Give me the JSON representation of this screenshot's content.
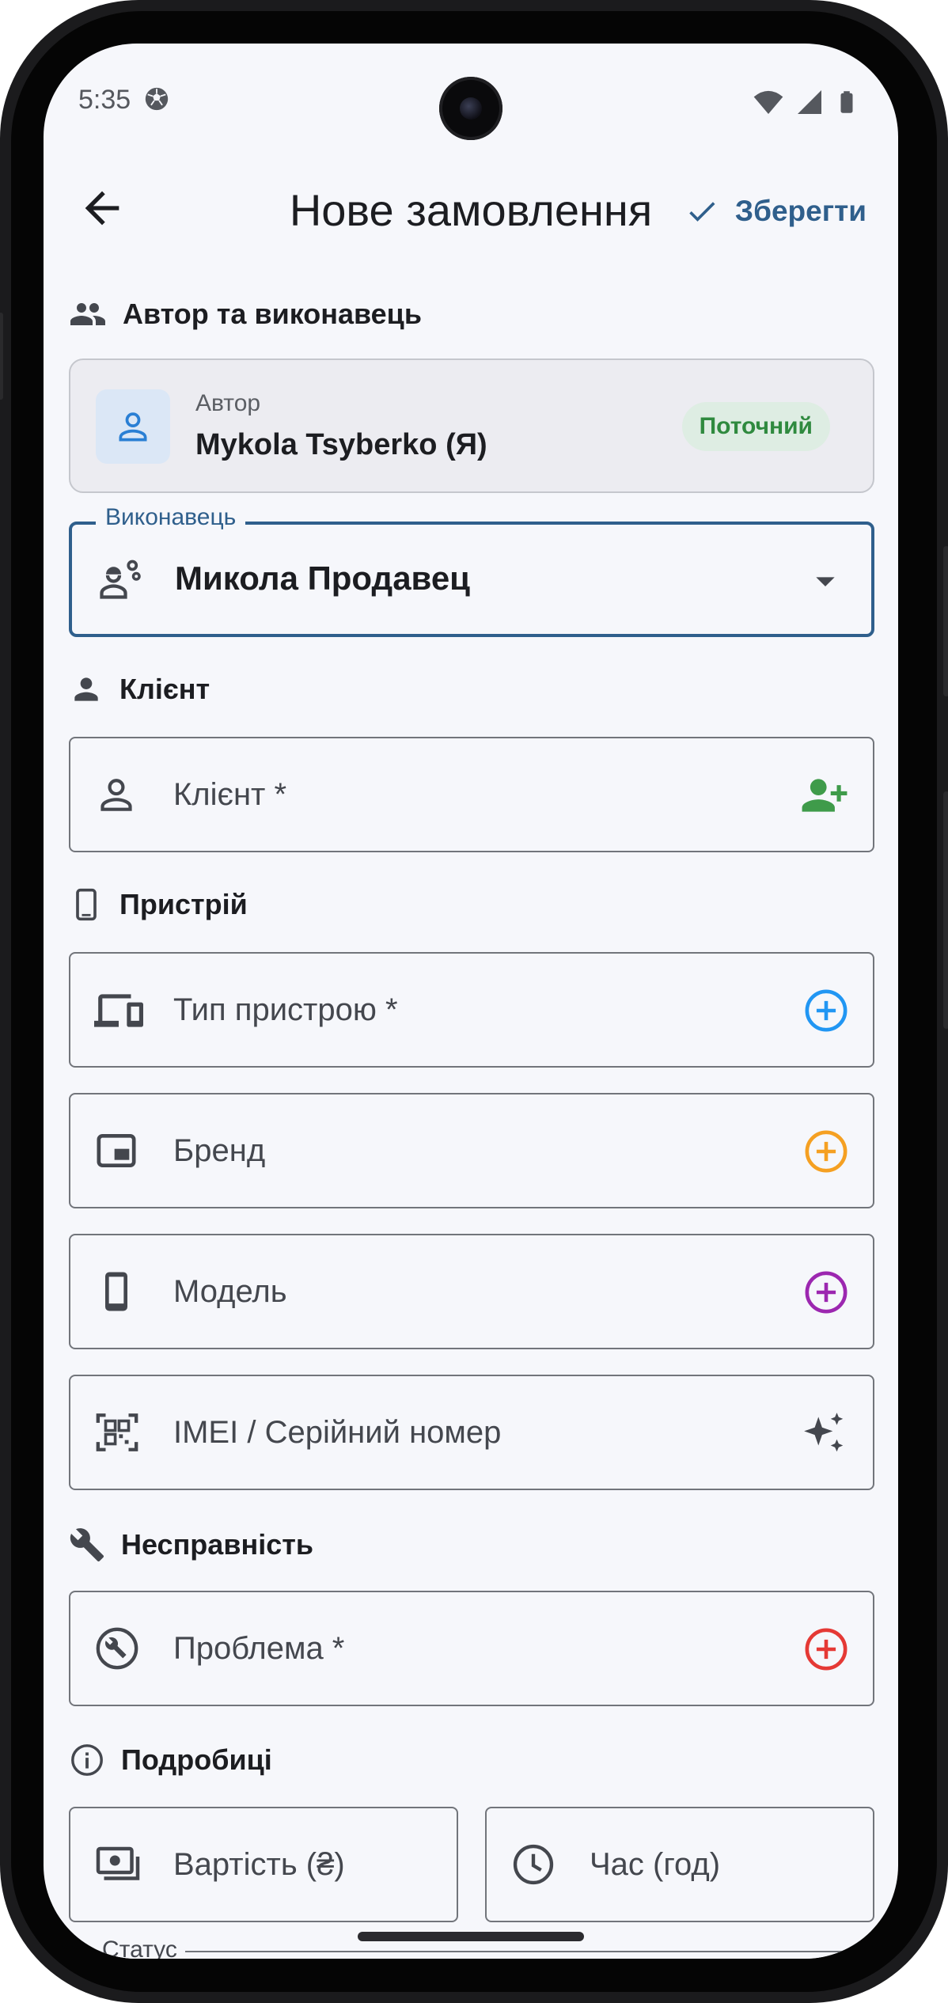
{
  "status_bar": {
    "time": "5:35"
  },
  "header": {
    "title": "Нове замовлення",
    "save_label": "Зберегти"
  },
  "sections": {
    "author_executor": "Автор та виконавець",
    "client": "Клієнт",
    "device": "Пристрій",
    "fault": "Несправність",
    "details": "Подробиці"
  },
  "author": {
    "label": "Автор",
    "name": "Mykola Tsyberko (Я)",
    "badge": "Поточний"
  },
  "executor": {
    "label": "Виконавець",
    "value": "Микола Продавец"
  },
  "fields": {
    "client": "Клієнт *",
    "device_type": "Тип пристрою *",
    "brand": "Бренд",
    "model": "Модель",
    "imei": "IMEI / Серійний номер",
    "problem": "Проблема *",
    "cost": "Вартість (₴)",
    "time": "Час (год)",
    "status": "Статус"
  },
  "colors": {
    "primary": "#2f5f8c",
    "client_add": "#3f9b4a",
    "device_type_add": "#2196f3",
    "brand_add": "#f5a022",
    "model_add": "#9c27b0",
    "problem_add": "#e53935",
    "badge_text": "#2f8a3f"
  }
}
